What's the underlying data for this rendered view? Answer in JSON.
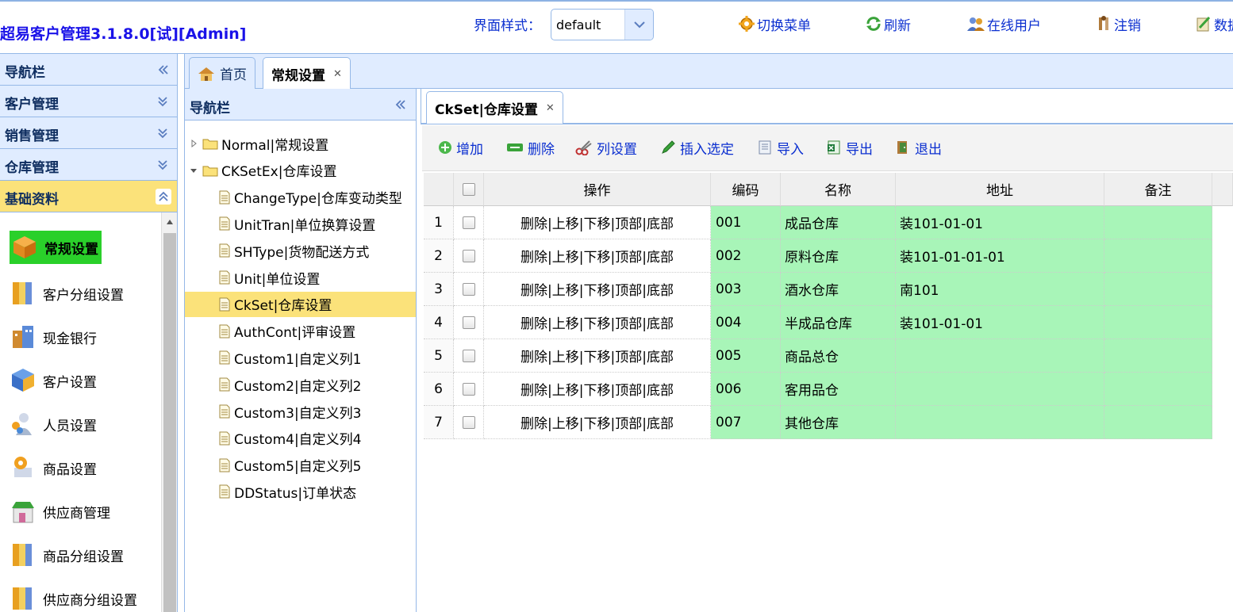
{
  "header": {
    "title": "超易客户管理3.1.8.0[试][Admin]",
    "theme_label": "界面样式：",
    "theme_value": "default",
    "links": [
      {
        "label": "切换菜单",
        "icon": "gear-icon"
      },
      {
        "label": "刷新",
        "icon": "refresh-icon"
      },
      {
        "label": "在线用户",
        "icon": "users-icon"
      },
      {
        "label": "注销",
        "icon": "logout-icon"
      },
      {
        "label": "数据",
        "icon": "data-icon"
      }
    ]
  },
  "west": {
    "title": "导航栏",
    "sections": [
      {
        "label": "客户管理",
        "expanded": false
      },
      {
        "label": "销售管理",
        "expanded": false
      },
      {
        "label": "仓库管理",
        "expanded": false
      },
      {
        "label": "基础资料",
        "expanded": true
      }
    ],
    "modules": [
      {
        "label": "常规设置",
        "active": true
      },
      {
        "label": "客户分组设置"
      },
      {
        "label": "现金银行"
      },
      {
        "label": "客户设置"
      },
      {
        "label": "人员设置"
      },
      {
        "label": "商品设置"
      },
      {
        "label": "供应商管理"
      },
      {
        "label": "商品分组设置"
      },
      {
        "label": "供应商分组设置"
      }
    ]
  },
  "tabs": [
    {
      "label": "首页",
      "icon": "home-icon"
    },
    {
      "label": "常规设置",
      "closable": true,
      "selected": true
    }
  ],
  "tree": {
    "title": "导航栏",
    "nodes": [
      {
        "label": "Normal|常规设置",
        "type": "folder",
        "state": "collapsed",
        "level": 0
      },
      {
        "label": "CKSetEx|仓库设置",
        "type": "folder",
        "state": "expanded",
        "level": 0
      },
      {
        "label": "ChangeType|仓库变动类型",
        "type": "file",
        "level": 1
      },
      {
        "label": "UnitTran|单位换算设置",
        "type": "file",
        "level": 1
      },
      {
        "label": "SHType|货物配送方式",
        "type": "file",
        "level": 1
      },
      {
        "label": "Unit|单位设置",
        "type": "file",
        "level": 1
      },
      {
        "label": "CkSet|仓库设置",
        "type": "file",
        "level": 1,
        "selected": true
      },
      {
        "label": "AuthCont|评审设置",
        "type": "file",
        "level": 1
      },
      {
        "label": "Custom1|自定义列1",
        "type": "file",
        "level": 1
      },
      {
        "label": "Custom2|自定义列2",
        "type": "file",
        "level": 1
      },
      {
        "label": "Custom3|自定义列3",
        "type": "file",
        "level": 1
      },
      {
        "label": "Custom4|自定义列4",
        "type": "file",
        "level": 1
      },
      {
        "label": "Custom5|自定义列5",
        "type": "file",
        "level": 1
      },
      {
        "label": "DDStatus|订单状态",
        "type": "file",
        "level": 1
      }
    ]
  },
  "inner_tab": {
    "label": "CkSet|仓库设置"
  },
  "toolbar": [
    {
      "label": "增加",
      "icon": "add-icon"
    },
    {
      "label": "删除",
      "icon": "remove-icon"
    },
    {
      "label": "列设置",
      "icon": "cut-icon"
    },
    {
      "label": "插入选定",
      "icon": "pencil-icon"
    },
    {
      "label": "导入",
      "icon": "import-icon"
    },
    {
      "label": "导出",
      "icon": "excel-icon"
    },
    {
      "label": "退出",
      "icon": "exit-icon"
    }
  ],
  "grid": {
    "columns": [
      "操作",
      "编码",
      "名称",
      "地址",
      "备注"
    ],
    "rows": [
      {
        "n": "1",
        "op": "删除|上移|下移|顶部|底部",
        "code": "001",
        "name": "成品仓库",
        "addr": "装101-01-01",
        "note": ""
      },
      {
        "n": "2",
        "op": "删除|上移|下移|顶部|底部",
        "code": "002",
        "name": "原料仓库",
        "addr": "装101-01-01-01",
        "note": ""
      },
      {
        "n": "3",
        "op": "删除|上移|下移|顶部|底部",
        "code": "003",
        "name": "酒水仓库",
        "addr": "南101",
        "note": ""
      },
      {
        "n": "4",
        "op": "删除|上移|下移|顶部|底部",
        "code": "004",
        "name": "半成品仓库",
        "addr": "装101-01-01",
        "note": ""
      },
      {
        "n": "5",
        "op": "删除|上移|下移|顶部|底部",
        "code": "005",
        "name": "商品总仓",
        "addr": "",
        "note": ""
      },
      {
        "n": "6",
        "op": "删除|上移|下移|顶部|底部",
        "code": "006",
        "name": "客用品仓",
        "addr": "",
        "note": ""
      },
      {
        "n": "7",
        "op": "删除|上移|下移|顶部|底部",
        "code": "007",
        "name": "其他仓库",
        "addr": "",
        "note": ""
      }
    ]
  },
  "colors": {
    "accent": "#0b2fd0",
    "panel": "#e0ecff",
    "selected": "#fbe27a",
    "row_fill": "#a8f5b8",
    "active_module": "#2ad02a"
  }
}
